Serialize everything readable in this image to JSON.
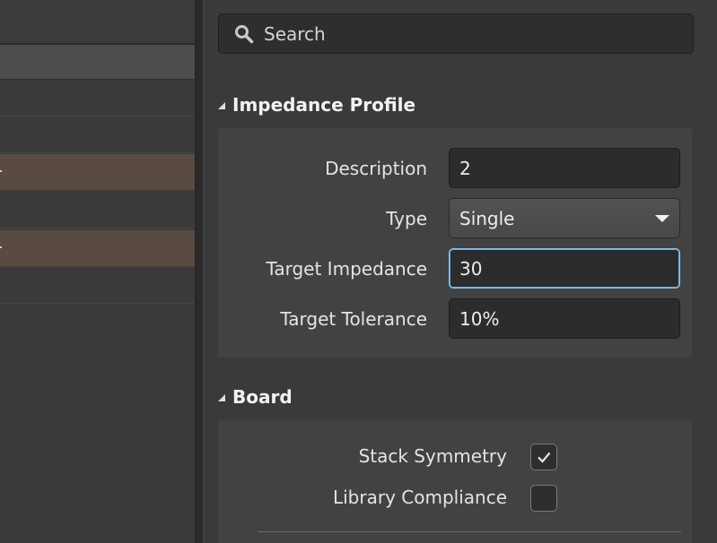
{
  "search": {
    "placeholder": "Search"
  },
  "impedance_profile": {
    "title": "Impedance Profile",
    "description": {
      "label": "Description",
      "value": "2"
    },
    "type": {
      "label": "Type",
      "value": "Single"
    },
    "target_impedance": {
      "label": "Target Impedance",
      "value": "30"
    },
    "target_tolerance": {
      "label": "Target Tolerance",
      "value": "10%"
    }
  },
  "board": {
    "title": "Board",
    "stack_symmetry": {
      "label": "Stack Symmetry",
      "checked": true
    },
    "library_compliance": {
      "label": "Library Compliance",
      "checked": false
    }
  },
  "colors": {
    "highlight_row": "#5a4b42",
    "focus_border": "#8fc4ee",
    "panel_bg": "#3a3a3a",
    "group_bg": "#424242"
  }
}
